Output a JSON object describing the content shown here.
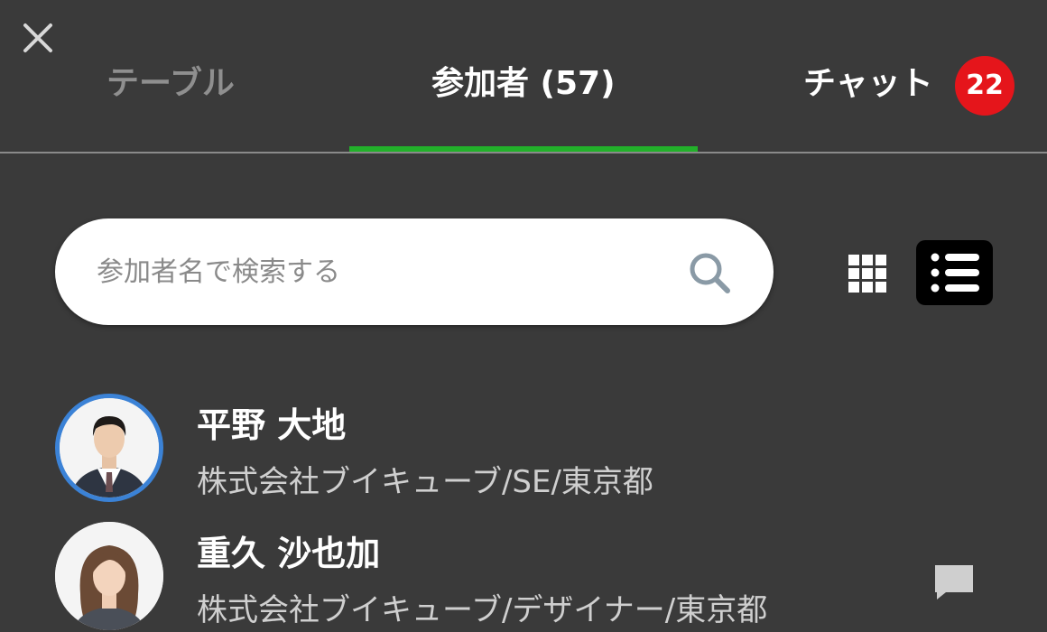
{
  "tabs": [
    {
      "label": "テーブル"
    },
    {
      "label": "参加者 (57)"
    },
    {
      "label": "チャット",
      "badge": "22"
    }
  ],
  "search": {
    "placeholder": "参加者名で検索する",
    "value": ""
  },
  "view_toggle": {
    "selected": "list"
  },
  "participants": [
    {
      "name": "平野 大地",
      "detail": "株式会社ブイキューブ/SE/東京都",
      "selected": true
    },
    {
      "name": "重久 沙也加",
      "detail": "株式会社ブイキューブ/デザイナー/東京都",
      "selected": false
    }
  ],
  "colors": {
    "background": "#3a3a3a",
    "active_tab_underline": "#22b02a",
    "badge": "#e5151b",
    "selected_avatar_ring": "#3b82d6"
  }
}
